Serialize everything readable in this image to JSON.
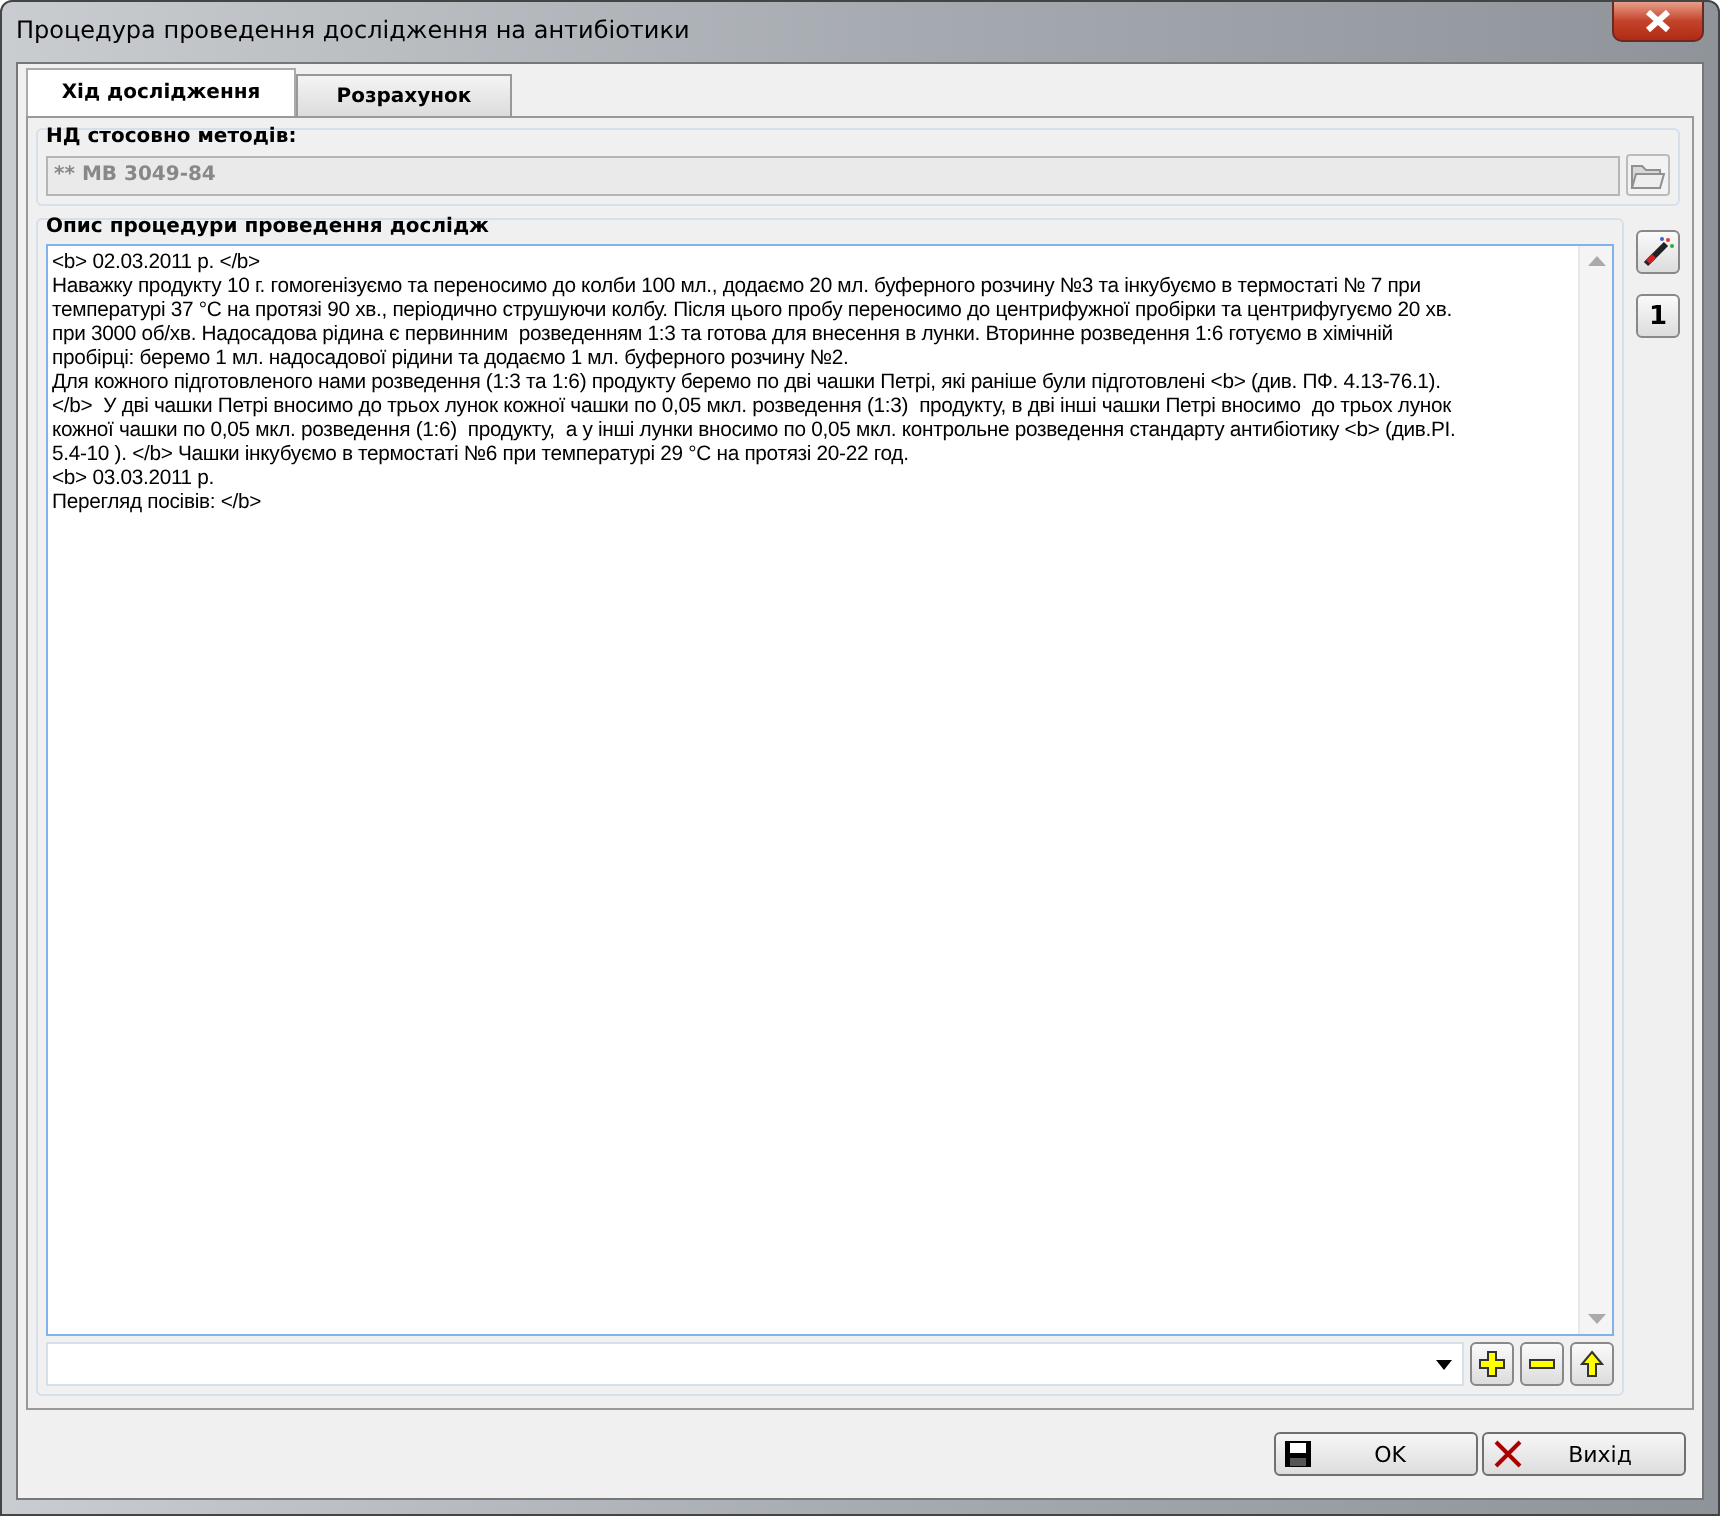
{
  "window": {
    "title": "Процедура проведення дослідження на антибіотики"
  },
  "tabs": [
    {
      "label": "Хід дослідження",
      "selected": true
    },
    {
      "label": "Розрахунок",
      "selected": false
    }
  ],
  "methods_group": {
    "label": "НД стосовно методів:",
    "field_value": "** МВ 3049-84",
    "disabled": true
  },
  "procedure_group": {
    "label": "Опис процедури проведення дослідж",
    "memo_lines": [
      "<b> 02.03.2011 р. </b>",
      "Наважку продукту 10 г. гомогенізуємо та переносимо до колби 100 мл., додаємо 20 мл. буферного розчину №3 та інкубуємо в термостаті № 7 при",
      "температурі 37 °С на протязі 90 хв., періодично струшуючи колбу. Після цього пробу переносимо до центрифужної пробірки та центрифугуємо 20 хв.",
      "при 3000 об/хв. Надосадова рідина є первинним  розведенням 1:3 та готова для внесення в лунки. Вторинне розведення 1:6 готуємо в хімічній",
      "пробірці: беремо 1 мл. надосадової рідини та додаємо 1 мл. буферного розчину №2.",
      "Для кожного підготовленого нами розведення (1:3 та 1:6) продукту беремо по дві чашки Петрі, які раніше були підготовлені <b> (див. ПФ. 4.13-76.1).",
      "</b>  У дві чашки Петрі вносимо до трьох лунок кожної чашки по 0,05 мкл. розведення (1:3)  продукту, в дві інші чашки Петрі вносимо  до трьох лунок",
      "кожної чашки по 0,05 мкл. розведення (1:6)  продукту,  а у інші лунки вносимо по 0,05 мкл. контрольне розведення стандарту антибіотику <b> (див.РІ.",
      "5.4-10 ). </b> Чашки інкубуємо в термостаті №6 при температурі 29 °С на протязі 20-22 год.",
      "<b> 03.03.2011 р.",
      "Перегляд посівів: </b>"
    ]
  },
  "side_buttons": [
    {
      "kind": "wand"
    },
    {
      "kind": "one",
      "label": "1"
    }
  ],
  "tool_buttons": [
    {
      "kind": "add"
    },
    {
      "kind": "remove"
    },
    {
      "kind": "up"
    }
  ],
  "buttons": [
    {
      "kind": "save",
      "label": "OK"
    },
    {
      "kind": "exit",
      "label": "Вихід"
    }
  ]
}
